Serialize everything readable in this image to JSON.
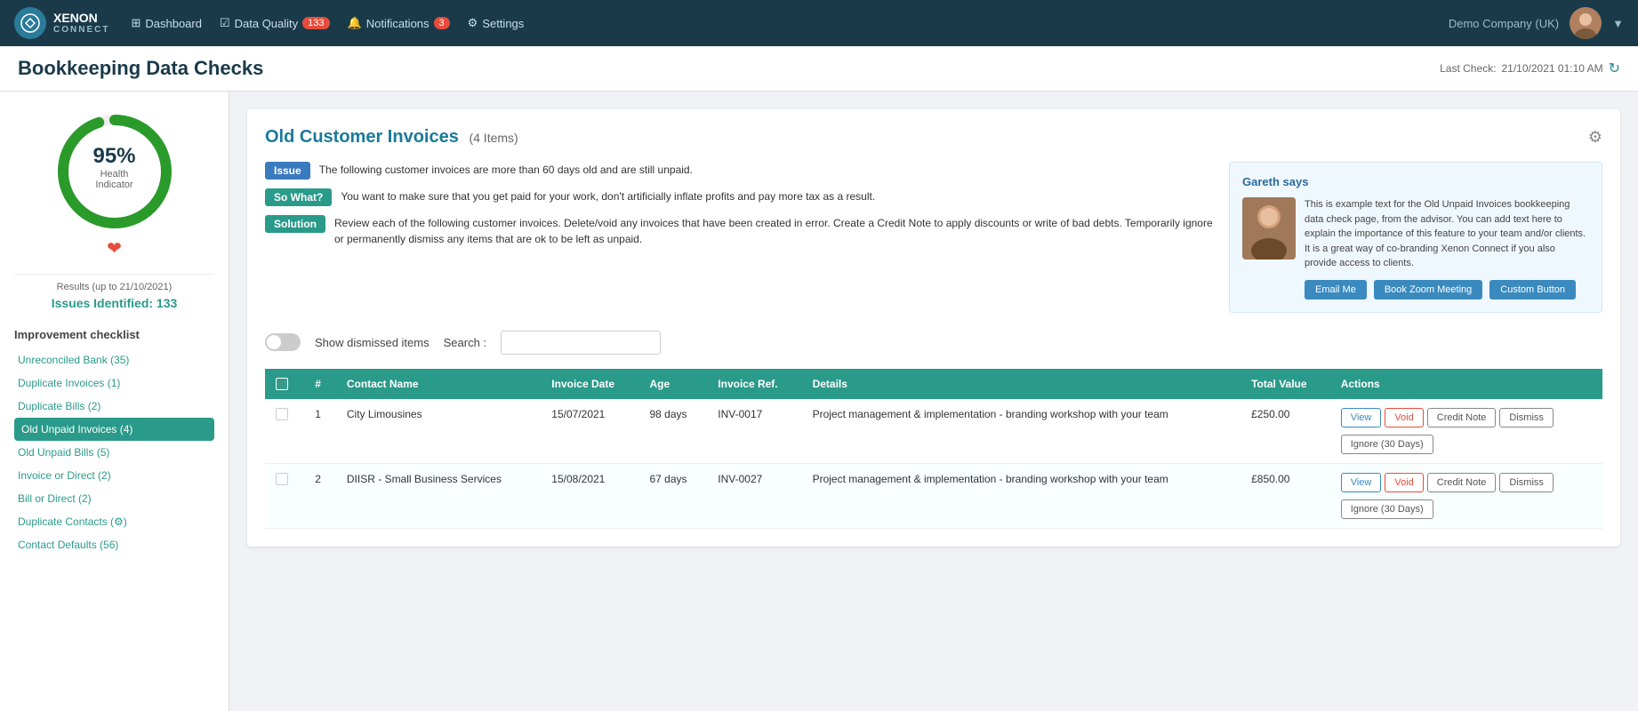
{
  "topnav": {
    "logo_text": "XENON\nCONNECT",
    "nav_items": [
      {
        "id": "dashboard",
        "label": "Dashboard",
        "icon": "grid-icon"
      },
      {
        "id": "data-quality",
        "label": "Data Quality",
        "badge": "133",
        "icon": "check-icon"
      },
      {
        "id": "notifications",
        "label": "Notifications",
        "badge": "3",
        "icon": "bell-icon"
      },
      {
        "id": "settings",
        "label": "Settings",
        "icon": "gear-icon"
      }
    ],
    "company": "Demo Company (UK)"
  },
  "page": {
    "title": "Bookkeeping Data Checks",
    "last_check_label": "Last Check:",
    "last_check_value": "21/10/2021 01:10 AM"
  },
  "sidebar": {
    "health_percent": "95%",
    "health_label": "Health Indicator",
    "results_label": "Results (up to 21/10/2021)",
    "issues_label": "Issues Identified: 133",
    "improvement_title": "Improvement checklist",
    "items": [
      {
        "label": "Unreconciled Bank (35)",
        "active": false
      },
      {
        "label": "Duplicate Invoices (1)",
        "active": false
      },
      {
        "label": "Duplicate Bills (2)",
        "active": false
      },
      {
        "label": "Old Unpaid Invoices (4)",
        "active": true
      },
      {
        "label": "Old Unpaid Bills (5)",
        "active": false
      },
      {
        "label": "Invoice or Direct (2)",
        "active": false
      },
      {
        "label": "Bill or Direct (2)",
        "active": false
      },
      {
        "label": "Duplicate Contacts (⚙)",
        "active": false
      },
      {
        "label": "Contact Defaults (56)",
        "active": false
      }
    ]
  },
  "content": {
    "section_title": "Old Customer Invoices",
    "item_count": "(4 Items)",
    "issue_tag": "Issue",
    "issue_text": "The following customer invoices are more than 60 days old and are still unpaid.",
    "sowhat_tag": "So What?",
    "sowhat_text": "You want to make sure that you get paid for your work, don't artificially inflate profits and pay more tax as a result.",
    "solution_tag": "Solution",
    "solution_text": "Review each of the following customer invoices. Delete/void any invoices that have been created in error. Create a Credit Note to apply discounts or write of bad debts. Temporarily ignore or permanently dismiss any items that are ok to be left as unpaid.",
    "advisor": {
      "name": "Gareth says",
      "text": "This is example text for the Old Unpaid Invoices bookkeeping data check page, from the advisor. You can add text here to explain the importance of this feature to your team and/or clients. It is a great way of co-branding Xenon Connect if you also provide access to clients.",
      "btn_email": "Email Me",
      "btn_zoom": "Book Zoom Meeting",
      "btn_custom": "Custom Button"
    },
    "filter": {
      "toggle_label": "Show dismissed items",
      "search_label": "Search :",
      "search_placeholder": ""
    },
    "table": {
      "headers": [
        "",
        "#",
        "Contact Name",
        "Invoice Date",
        "Age",
        "Invoice Ref.",
        "Details",
        "Total Value",
        "Actions"
      ],
      "rows": [
        {
          "num": "1",
          "contact": "City Limousines",
          "date": "15/07/2021",
          "age": "98 days",
          "ref": "INV-0017",
          "details": "Project management & implementation - branding workshop with your team",
          "value": "£250.00",
          "actions": [
            "View",
            "Void",
            "Credit Note",
            "Dismiss",
            "Ignore (30 Days)"
          ]
        },
        {
          "num": "2",
          "contact": "DIISR - Small Business Services",
          "date": "15/08/2021",
          "age": "67 days",
          "ref": "INV-0027",
          "details": "Project management & implementation - branding workshop with your team",
          "value": "£850.00",
          "actions": [
            "View",
            "Void",
            "Credit Note",
            "Dismiss",
            "Ignore (30 Days)"
          ]
        }
      ]
    }
  }
}
